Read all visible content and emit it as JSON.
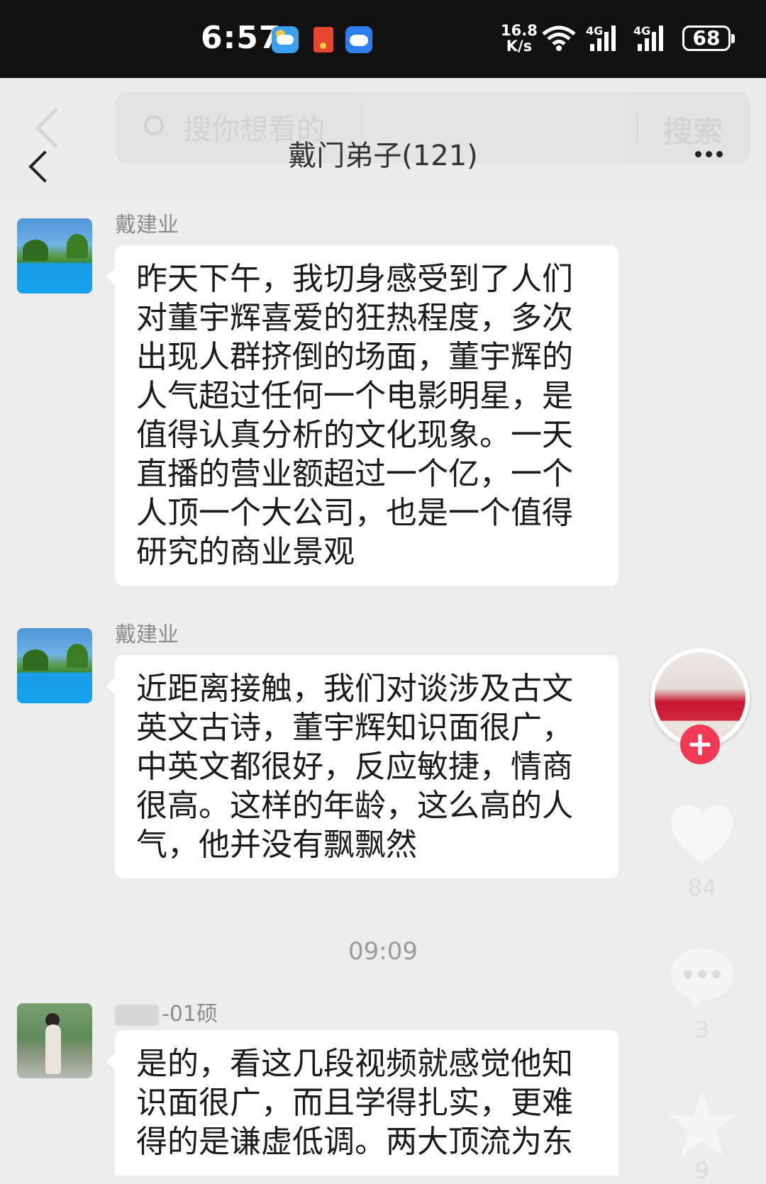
{
  "status_bar": {
    "time": "6:57",
    "network_speed_value": "16.8",
    "network_speed_unit": "K/s",
    "signal_1": "4G",
    "signal_2": "4G",
    "battery": "68"
  },
  "header": {
    "search_placeholder": "搜你想看的",
    "search_button": "搜索",
    "title": "戴门弟子(121)"
  },
  "messages": [
    {
      "sender": "戴建业",
      "text": "昨天下午，我切身感受到了人们对董宇辉喜爱的狂热程度，多次出现人群挤倒的场面，董宇辉的人气超过任何一个电影明星，是值得认真分析的文化现象。一天直播的营业额超过一个亿，一个人顶一个大公司，也是一个值得研究的商业景观"
    },
    {
      "sender": "戴建业",
      "text": "近距离接触，我们对谈涉及古文英文古诗，董宇辉知识面很广，中英文都很好，反应敏捷，情商很高。这样的年龄，这么高的人气，他并没有飘飘然"
    },
    {
      "sender": "-01硕",
      "text": "是的，看这几段视频就感觉他知识面很广，而且学得扎实，更难得的是谦虚低调。两大顶流为东"
    }
  ],
  "timestamp": "09:09",
  "overlay": {
    "follow_label": "+",
    "like_count": "84",
    "comment_count": "3",
    "favorite_count": "9"
  }
}
